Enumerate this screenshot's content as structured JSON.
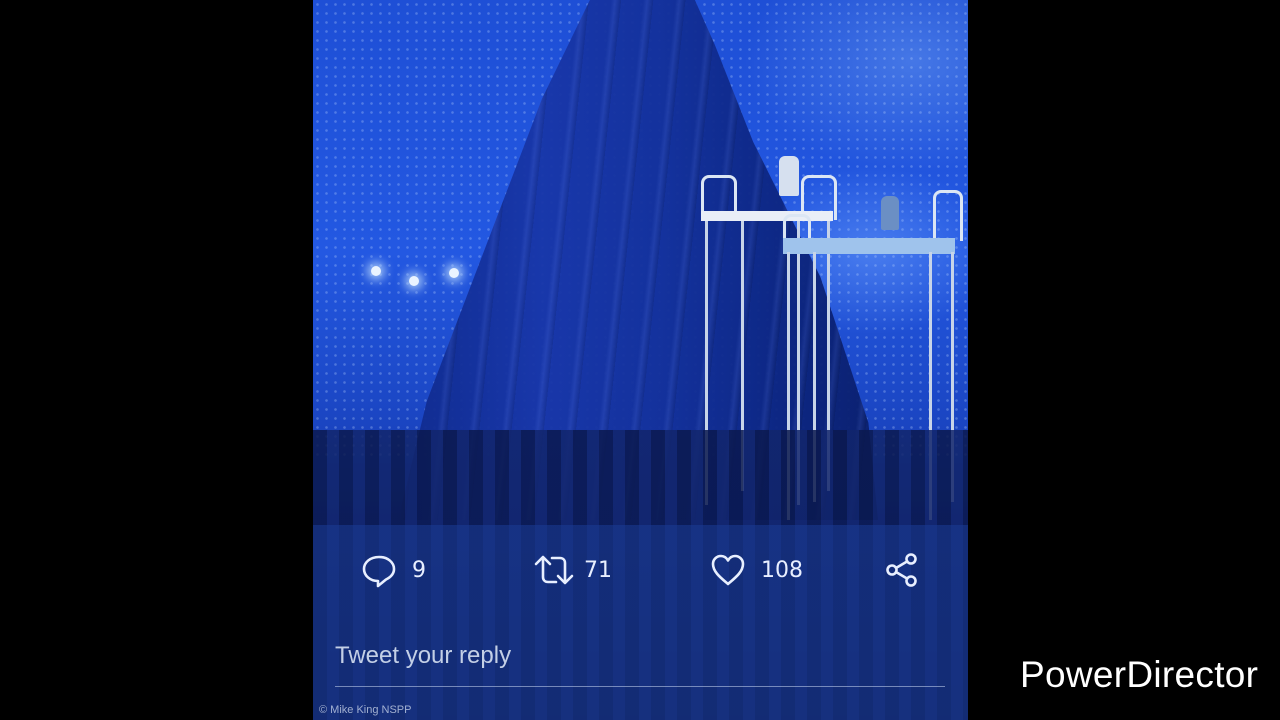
{
  "tweet": {
    "actions": {
      "reply": {
        "icon": "reply-bubble-icon",
        "count": "9"
      },
      "retweet": {
        "icon": "retweet-icon",
        "count": "71"
      },
      "like": {
        "icon": "heart-icon",
        "count": "108"
      },
      "share": {
        "icon": "share-icon"
      }
    },
    "reply_placeholder": "Tweet your reply",
    "photo_credit": "© Mike King NSPP"
  },
  "watermark": {
    "text": "PowerDirector"
  },
  "colors": {
    "background": "#000000",
    "photo_blue": "#1e4fd6",
    "overlay": "#1c3c96",
    "icon_text": "#e8efff"
  }
}
